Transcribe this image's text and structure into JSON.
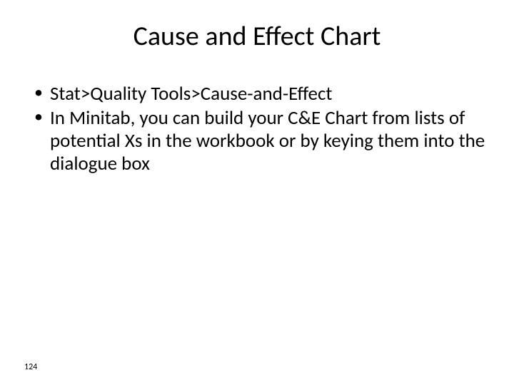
{
  "title": "Cause and Effect Chart",
  "bullets": [
    "Stat>Quality Tools>Cause-and-Effect",
    "In Minitab, you can build your C&E Chart from lists of potential Xs in the workbook or by keying them into the dialogue box"
  ],
  "page_number": "124"
}
